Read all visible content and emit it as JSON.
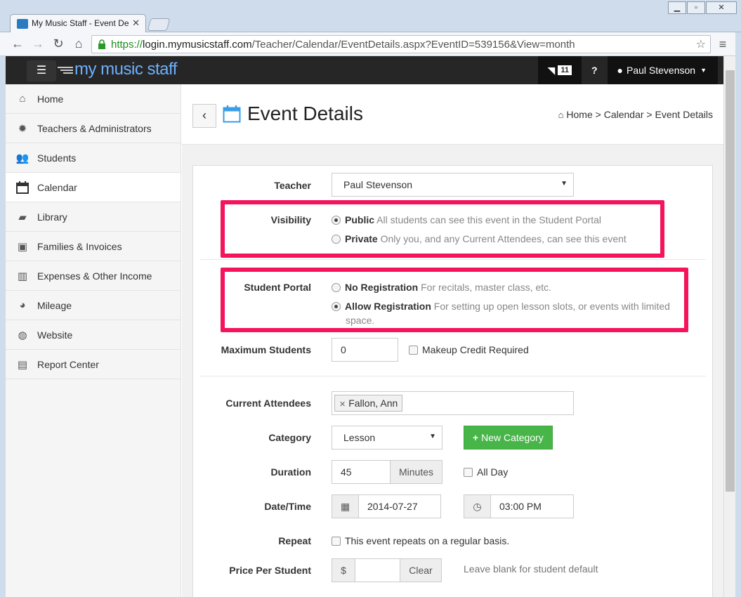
{
  "browser": {
    "tab_title": "My Music Staff - Event De",
    "url_scheme": "https://",
    "url_host": "login.mymusicstaff.com",
    "url_path": "/Teacher/Calendar/EventDetails.aspx?EventID=539156&View=month"
  },
  "navbar": {
    "brand": "my music staff",
    "feed_count": "11",
    "user_name": "Paul Stevenson"
  },
  "sidebar": {
    "items": [
      {
        "label": "Home",
        "icon": "home-icon"
      },
      {
        "label": "Teachers & Administrators",
        "icon": "gear-icon"
      },
      {
        "label": "Students",
        "icon": "users-icon"
      },
      {
        "label": "Calendar",
        "icon": "calendar-icon"
      },
      {
        "label": "Library",
        "icon": "book-icon"
      },
      {
        "label": "Families & Invoices",
        "icon": "money-icon"
      },
      {
        "label": "Expenses & Other Income",
        "icon": "bar-chart-icon"
      },
      {
        "label": "Mileage",
        "icon": "dashboard-icon"
      },
      {
        "label": "Website",
        "icon": "globe-icon"
      },
      {
        "label": "Report Center",
        "icon": "document-icon"
      }
    ],
    "active": "Calendar"
  },
  "header": {
    "title": "Event Details",
    "breadcrumb": [
      "Home",
      "Calendar",
      "Event Details"
    ]
  },
  "form": {
    "teacher": {
      "label": "Teacher",
      "value": "Paul Stevenson"
    },
    "visibility": {
      "label": "Visibility",
      "options": [
        {
          "title": "Public",
          "desc": "All students can see this event in the Student Portal",
          "checked": true
        },
        {
          "title": "Private",
          "desc": "Only you, and any Current Attendees, can see this event",
          "checked": false
        }
      ]
    },
    "student_portal": {
      "label": "Student Portal",
      "options": [
        {
          "title": "No Registration",
          "desc": "For recitals, master class, etc.",
          "checked": false
        },
        {
          "title": "Allow Registration",
          "desc": "For setting up open lesson slots, or events with limited",
          "desc2": "space.",
          "checked": true
        }
      ]
    },
    "max_students": {
      "label": "Maximum Students",
      "value": "0",
      "makeup_label": "Makeup Credit Required"
    },
    "attendees": {
      "label": "Current Attendees",
      "tags": [
        "Fallon, Ann"
      ]
    },
    "category": {
      "label": "Category",
      "value": "Lesson",
      "new_button": "New Category"
    },
    "duration": {
      "label": "Duration",
      "value": "45",
      "unit": "Minutes",
      "all_day_label": "All Day"
    },
    "datetime": {
      "label": "Date/Time",
      "date": "2014-07-27",
      "time": "03:00 PM"
    },
    "repeat": {
      "label": "Repeat",
      "checkbox_label": "This event repeats on a regular basis."
    },
    "price": {
      "label": "Price Per Student",
      "currency": "$",
      "clear": "Clear",
      "hint": "Leave blank for student default"
    }
  },
  "colors": {
    "highlight": "#f5135b",
    "navbar": "#262626",
    "brand": "#6cb0ff",
    "button_green": "#47b548"
  }
}
